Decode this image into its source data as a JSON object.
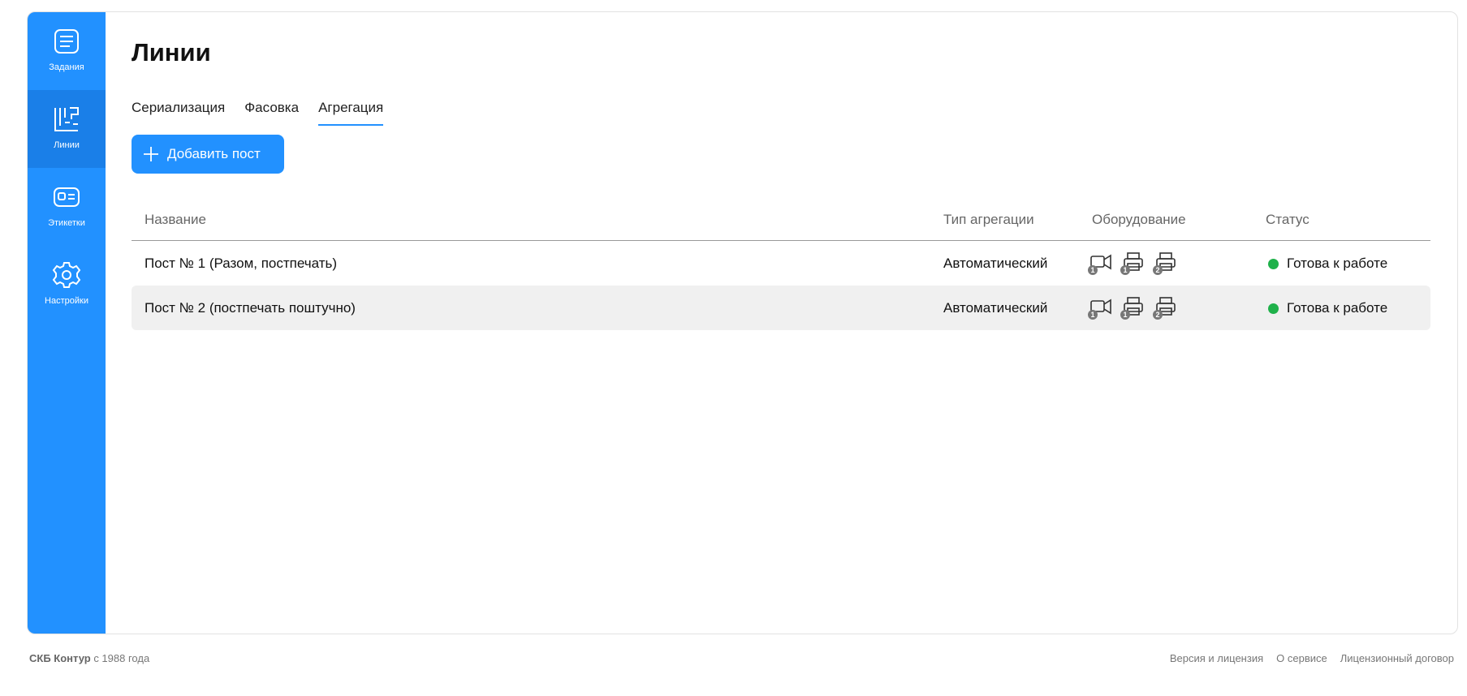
{
  "sidebar": {
    "items": [
      {
        "label": "Задания",
        "icon": "tasks-icon"
      },
      {
        "label": "Линии",
        "icon": "lines-icon",
        "active": true
      },
      {
        "label": "Этикетки",
        "icon": "label-icon"
      },
      {
        "label": "Настройки",
        "icon": "gear-icon"
      }
    ]
  },
  "page": {
    "title": "Линии",
    "tabs": [
      "Сериализация",
      "Фасовка",
      "Агрегация"
    ],
    "active_tab": "Агрегация",
    "add_button": "Добавить пост"
  },
  "table": {
    "columns": [
      "Название",
      "Тип агрегации",
      "Оборудование",
      "Статус"
    ],
    "rows": [
      {
        "name": "Пост № 1 (Разом, постпечать)",
        "type": "Автоматический",
        "equipment": [
          {
            "icon": "camera-icon",
            "badge": "1"
          },
          {
            "icon": "printer-icon",
            "badge": "1"
          },
          {
            "icon": "printer-icon",
            "badge": "2"
          }
        ],
        "status": "Готова к работе"
      },
      {
        "name": "Пост № 2 (постпечать поштучно)",
        "type": "Автоматический",
        "equipment": [
          {
            "icon": "camera-icon",
            "badge": "1"
          },
          {
            "icon": "printer-icon",
            "badge": "1"
          },
          {
            "icon": "printer-icon",
            "badge": "2"
          }
        ],
        "status": "Готова к работе"
      }
    ]
  },
  "footer": {
    "brand": "СКБ Контур",
    "since": " с 1988 года",
    "links": [
      "Версия и лицензия",
      "О сервисе",
      "Лицензионный договор"
    ]
  },
  "colors": {
    "accent": "#2291ff",
    "status_ok": "#1fb14a"
  }
}
